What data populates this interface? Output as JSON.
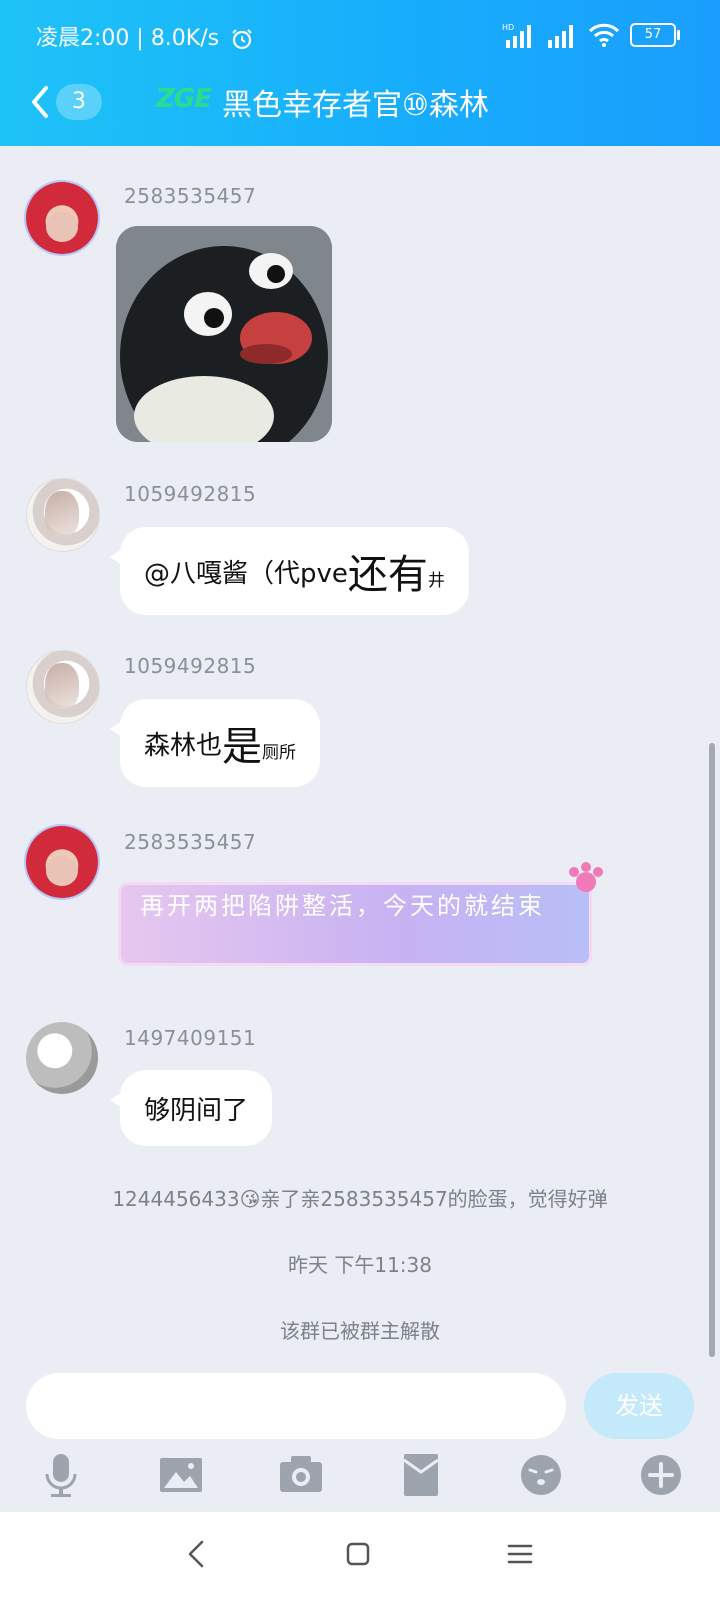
{
  "status_bar": {
    "time": "凌晨2:00",
    "network_speed": "8.0K/s",
    "signal_label": "HD",
    "battery": "57"
  },
  "header": {
    "unread_count": "3",
    "group_tag": "ZGE",
    "title": "黑色幸存者官⑩森林"
  },
  "messages": [
    {
      "sender": "2583535457",
      "type": "sticker",
      "sticker": "penguin-sticker"
    },
    {
      "sender": "1059492815",
      "parts": [
        "@八嘎酱（代pve ",
        "还有",
        "井"
      ]
    },
    {
      "sender": "1059492815",
      "parts": [
        "森林也",
        "是",
        "厕所"
      ]
    },
    {
      "sender": "2583535457",
      "text": "再开两把陷阱整活，今天的就结束"
    },
    {
      "sender": "1497409151",
      "text": "够阴间了"
    }
  ],
  "system_messages": {
    "poke": "1244456433😘亲了亲2583535457的脸蛋，觉得好弹",
    "timestamp": "昨天 下午11:38",
    "notice": "该群已被群主解散"
  },
  "input": {
    "placeholder": "",
    "send_label": "发送"
  },
  "toolbar": [
    "mic-icon",
    "image-icon",
    "camera-icon",
    "red-packet-icon",
    "emoji-icon",
    "plus-icon"
  ],
  "colors": {
    "header_start": "#1ec3f7",
    "header_end": "#1a9efd",
    "background": "#eaedf4",
    "send_disabled": "#c4e9fb"
  }
}
